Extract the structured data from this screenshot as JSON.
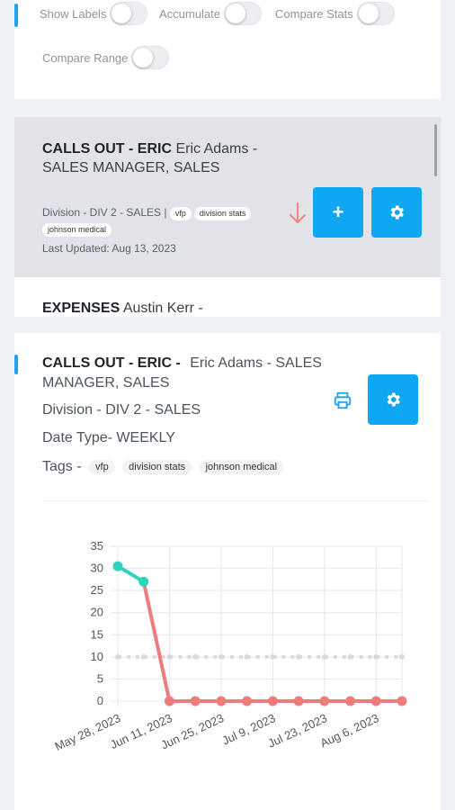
{
  "settings": {
    "toggles": [
      {
        "label": "Show Labels",
        "on": false
      },
      {
        "label": "Accumulate",
        "on": false
      },
      {
        "label": "Compare Stats",
        "on": false
      },
      {
        "label": "Compare Range",
        "on": false
      }
    ]
  },
  "list": {
    "active_item": {
      "title_bold": "CALLS OUT - ERIC",
      "title_rest": "Eric Adams - SALES MANAGER, SALES",
      "division": "Division - DIV 2 - SALES |",
      "tags": [
        "vfp",
        "division stats",
        "johnson medical"
      ],
      "updated": "Last Updated: Aug 13, 2023",
      "add_label": "+",
      "trend_icon": "arrow-down-icon",
      "trend_color": "#f08a84"
    },
    "next_item": {
      "title_bold": "EXPENSES",
      "title_rest": "Austin Kerr -"
    }
  },
  "detail": {
    "title_bold": "CALLS OUT - ERIC -",
    "title_rest": "Eric Adams - SALES MANAGER, SALES",
    "division": "Division - DIV 2 - SALES",
    "date_type": "Date Type- WEEKLY",
    "tags_label": "Tags -",
    "tags": [
      "vfp",
      "division stats",
      "johnson medical"
    ]
  },
  "colors": {
    "accent": "#0fa6f2",
    "line_up": "#2fd4bd",
    "line_down": "#ef7c7c",
    "compare": "#d8dadd"
  },
  "chart_data": {
    "type": "line",
    "title": "",
    "xlabel": "",
    "ylabel": "",
    "ylim": [
      0,
      35
    ],
    "yticks": [
      0,
      5,
      10,
      15,
      20,
      25,
      30,
      35
    ],
    "x_tick_labels": [
      "May 28, 2023",
      "Jun 11, 2023",
      "Jun 25, 2023",
      "Jul 9, 2023",
      "Jul 23, 2023",
      "Aug 6, 2023"
    ],
    "x": [
      "May 28, 2023",
      "Jun 4, 2023",
      "Jun 11, 2023",
      "Jun 18, 2023",
      "Jun 25, 2023",
      "Jul 2, 2023",
      "Jul 9, 2023",
      "Jul 16, 2023",
      "Jul 23, 2023",
      "Jul 30, 2023",
      "Aug 6, 2023",
      "Aug 13, 2023"
    ],
    "series": [
      {
        "values": [
          30.5,
          27,
          0,
          0,
          0,
          0,
          0,
          0,
          0,
          0,
          0,
          0
        ]
      },
      {
        "style": "dotted",
        "values": [
          10,
          10,
          10,
          10,
          10,
          10,
          10,
          10,
          10,
          10,
          10,
          10
        ]
      }
    ],
    "grid": true,
    "legend": "none"
  }
}
